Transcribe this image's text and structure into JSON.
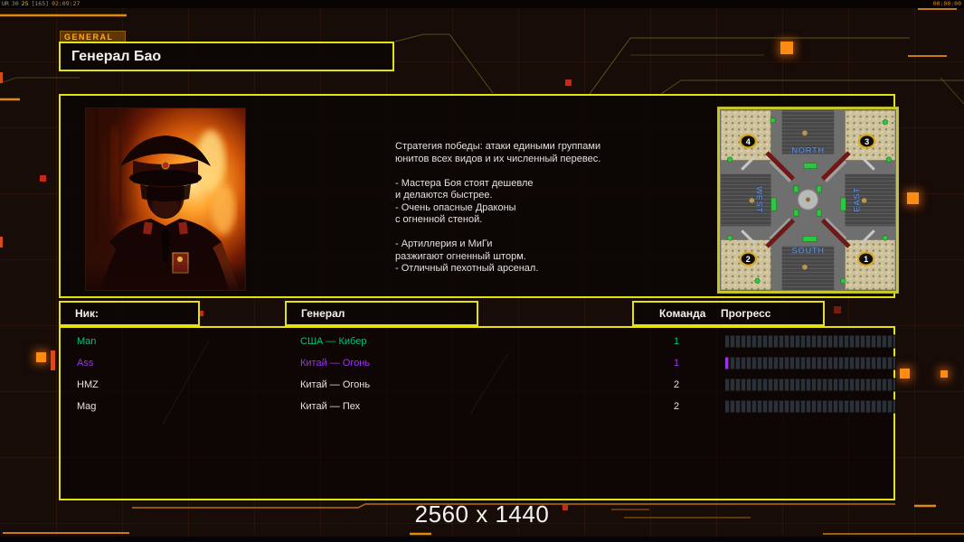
{
  "hud": {
    "parts": [
      {
        "text": "UR",
        "color": "#9a9a9a"
      },
      {
        "text": "30",
        "color": "#3ec43e"
      },
      {
        "text": "25",
        "color": "#d8c828"
      },
      {
        "text": "[165]",
        "color": "#8a8a8a"
      },
      {
        "text": "02:09:27",
        "color": "#e0821e"
      }
    ],
    "clock": "00:00:00"
  },
  "header": {
    "tab_label": "GENERAL",
    "title": "Генерал Бао"
  },
  "briefing": {
    "text": "Стратегия победы: атаки едиными группами\nюнитов всех видов и их численный перевес.\n\n- Мастера Боя стоят дешевле\nи делаются быстрее.\n- Очень опасные Драконы\nс огненной стеной.\n\n- Артиллерия и МиГи\nразжигают огненный шторм.\n- Отличный пехотный арсенал."
  },
  "minimap": {
    "labels": {
      "north": "NORTH",
      "south": "SOUTH",
      "west": "WEST",
      "east": "EAST"
    },
    "spawns": {
      "tl": "4",
      "tr": "3",
      "bl": "2",
      "br": "1"
    }
  },
  "table": {
    "headers": {
      "nick": "Ник:",
      "general": "Генерал",
      "team": "Команда",
      "progress": "Прогресс"
    },
    "players": [
      {
        "nick": "Man",
        "general": "США — Кибер",
        "team": "1",
        "color": "#00c377",
        "progress_pct": 0
      },
      {
        "nick": "Ass",
        "general": "Китай — Огонь",
        "team": "1",
        "color": "#9a34e8",
        "progress_pct": 1.6
      },
      {
        "nick": "HMZ",
        "general": "Китай — Огонь",
        "team": "2",
        "color": "#e6e2de",
        "progress_pct": 0
      },
      {
        "nick": "Mag",
        "general": "Китай — Пех",
        "team": "2",
        "color": "#e6e2de",
        "progress_pct": 0
      }
    ]
  },
  "footer": {
    "resolution": "2560 x 1440"
  },
  "colors": {
    "accent_yellow": "#e3e20e",
    "accent_orange": "#e08a10",
    "background": "#170c08"
  }
}
